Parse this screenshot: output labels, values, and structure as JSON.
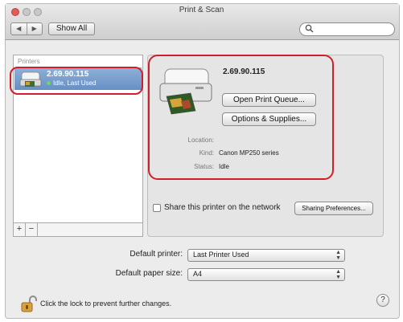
{
  "window": {
    "title": "Print & Scan"
  },
  "toolbar": {
    "back_glyph": "◀",
    "forward_glyph": "▶",
    "show_all_label": "Show All",
    "search_placeholder": "",
    "search_value": ""
  },
  "printers": {
    "header": "Printers",
    "items": [
      {
        "name": "2.69.90.115",
        "status": "Idle, Last Used",
        "selected": true
      }
    ],
    "add_label": "+",
    "remove_label": "−"
  },
  "detail": {
    "printer_name": "2.69.90.115",
    "open_queue_label": "Open Print Queue...",
    "options_supplies_label": "Options & Supplies...",
    "location_label": "Location:",
    "location_value": "",
    "kind_label": "Kind:",
    "kind_value": "Canon MP250 series",
    "status_label": "Status:",
    "status_value": "Idle"
  },
  "sharing": {
    "checkbox_label": "Share this printer on the network",
    "checked": false,
    "preferences_label": "Sharing Preferences..."
  },
  "defaults": {
    "printer_label": "Default printer:",
    "printer_value": "Last Printer Used",
    "paper_label": "Default paper size:",
    "paper_value": "A4"
  },
  "footer": {
    "lock_text": "Click the lock to prevent further changes.",
    "help_label": "?"
  },
  "colors": {
    "annotation": "#d11f2a",
    "selection": "#6690c4",
    "close_button": "#e25c55"
  },
  "icons": {
    "printer": "printer-icon",
    "lock": "lock-open-icon",
    "search": "search-icon"
  }
}
